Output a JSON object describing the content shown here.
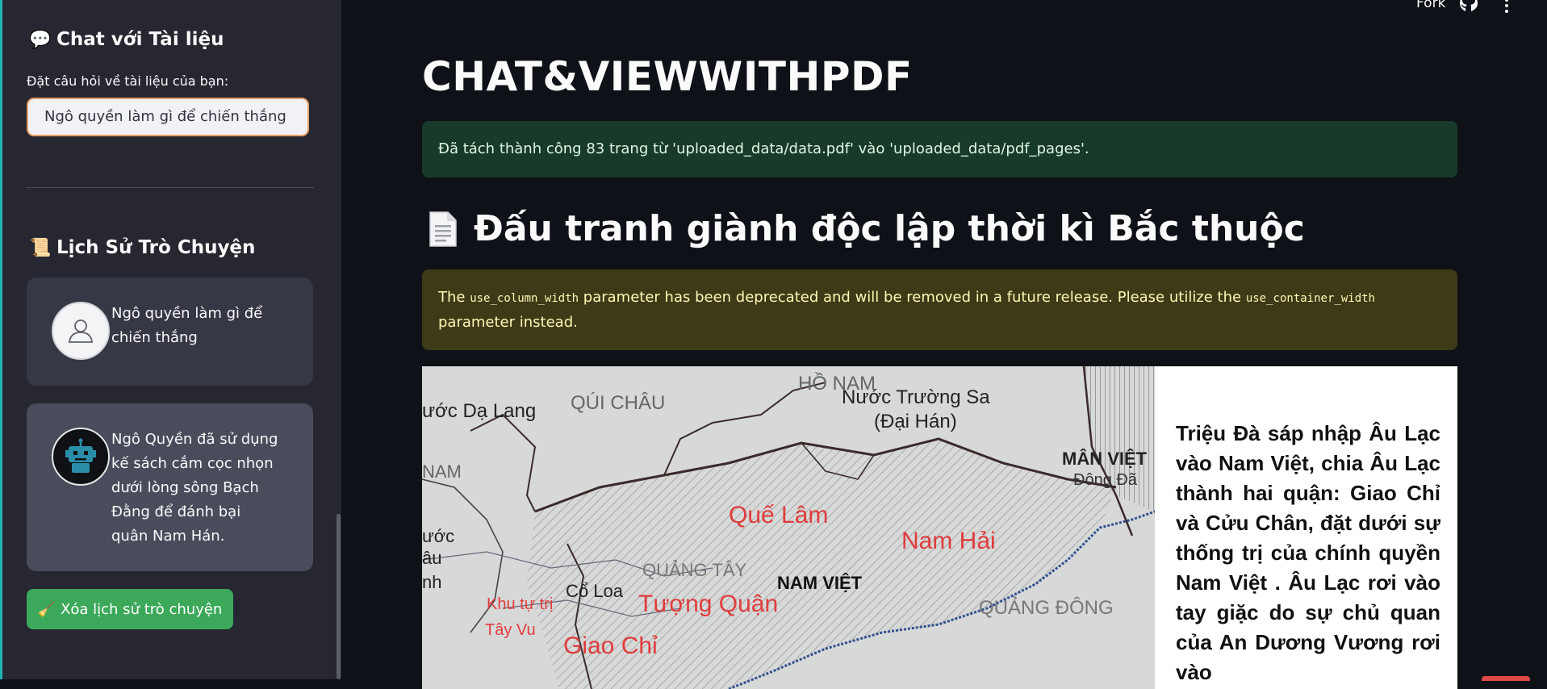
{
  "sidebar": {
    "chat_header": {
      "icon": "speech-bubble-icon",
      "icon_glyph": "💬",
      "title": "Chat với Tài liệu"
    },
    "question_label": "Đặt câu hỏi về tài liệu của bạn:",
    "question_value": "Ngô quyền làm gì để chiến thắng",
    "history_header": {
      "icon": "scroll-icon",
      "icon_glyph": "📜",
      "title": "Lịch Sử Trò Chuyện"
    },
    "messages": [
      {
        "role": "user",
        "avatar": "user-avatar-icon",
        "text": "Ngô quyền làm gì để chiến thắng"
      },
      {
        "role": "assistant",
        "avatar": "robot-avatar-icon",
        "text": "Ngô Quyền đã sử dụng kế sách cắm cọc nhọn dưới lòng sông Bạch Đằng để đánh bại quân Nam Hán."
      }
    ],
    "clear_button": {
      "icon": "broom-icon",
      "icon_glyph": "🧹",
      "label": "Xóa lịch sử trò chuyện"
    }
  },
  "topbar": {
    "fork_label": "Fork",
    "github_icon": "github-icon",
    "menu_icon": "kebab-menu-icon"
  },
  "main": {
    "title": "CHAT&VIEWWITHPDF",
    "success_message": "Đã tách thành công 83 trang từ 'uploaded_data/data.pdf' vào 'uploaded_data/pdf_pages'.",
    "doc_header": {
      "icon": "page-icon",
      "title": "Đấu tranh giành độc lập thời kì Bắc thuộc"
    },
    "warning": {
      "part1": "The ",
      "code1": "use_column_width",
      "part2": " parameter has been deprecated and will be removed in a future release. Please utilize the ",
      "code2": "use_container_width",
      "part3": " parameter instead."
    },
    "pdf_page": {
      "map_labels": [
        "ước Dạ Lang",
        "QÚI CHÂU",
        "HỒ NAM",
        "Nước Trường Sa",
        "(Đại Hán)",
        "NAM",
        "MÂN VIỆT",
        "Đông Đã",
        "ước",
        "âu",
        "nh",
        "Quế Lâm",
        "Nam Hải",
        "QUẢNG TÂY",
        "NAM VIỆT",
        "Cổ Loa",
        "Tượng Quận",
        "Khu tự trị",
        "Tây Vu",
        "Giao Chỉ",
        "QUẢNG ĐÔNG"
      ],
      "text": "Triệu Đà sáp nhập Âu Lạc vào Nam Việt, chia Âu Lạc thành hai quận: Giao Chỉ và Cửu Chân, đặt dưới sự thống trị của chính quyền Nam Việt . Âu Lạc rơi vào tay giặc do sự chủ quan của An Dương Vương rơi vào"
    }
  }
}
